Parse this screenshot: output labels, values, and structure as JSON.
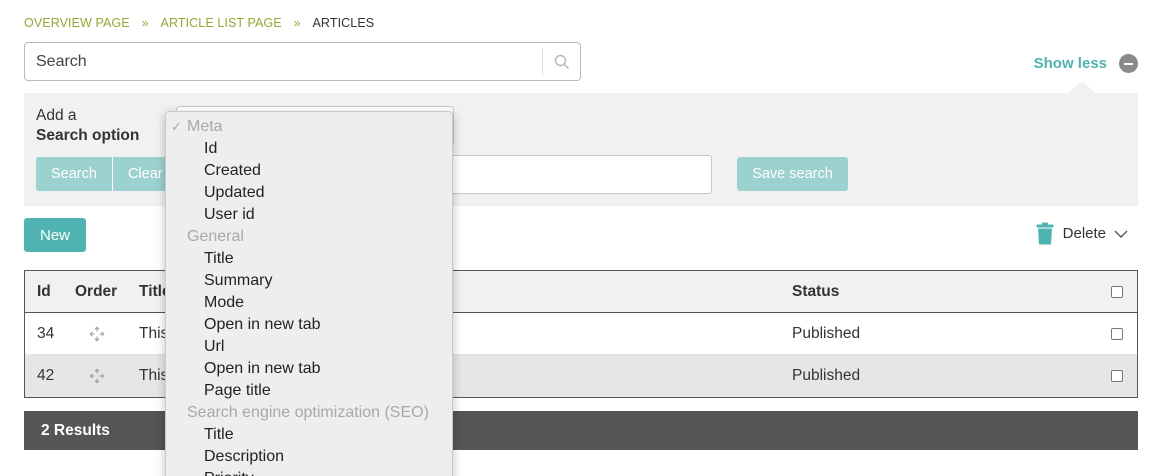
{
  "breadcrumb": {
    "items": [
      "OVERVIEW PAGE",
      "ARTICLE LIST PAGE"
    ],
    "separator": "»",
    "current": "ARTICLES"
  },
  "search": {
    "placeholder": "Search"
  },
  "toggle": {
    "show_less_label": "Show less"
  },
  "options_panel": {
    "add_label_line1": "Add a",
    "add_label_line2": "Search option",
    "search_button": "Search",
    "clear_button": "Clear",
    "save_button": "Save search"
  },
  "toolbar": {
    "new_button": "New",
    "delete_label": "Delete"
  },
  "table": {
    "headers": {
      "id": "Id",
      "order": "Order",
      "title": "Title",
      "status": "Status"
    },
    "rows": [
      {
        "id": "34",
        "title": "This",
        "status": "Published"
      },
      {
        "id": "42",
        "title": "This",
        "status": "Published"
      }
    ]
  },
  "results": {
    "label": "2 Results"
  },
  "dropdown": {
    "groups": [
      {
        "label": "Meta",
        "items": [
          "Id",
          "Created",
          "Updated",
          "User id"
        ]
      },
      {
        "label": "General",
        "items": [
          "Title",
          "Summary",
          "Mode",
          "Open in new tab",
          "Url",
          "Open in new tab",
          "Page title"
        ]
      },
      {
        "label": "Search engine optimization (SEO)",
        "items": [
          "Title",
          "Description",
          "Priority"
        ]
      }
    ]
  },
  "colors": {
    "accent": "#4fb3b1",
    "accent_light": "#9bd2d0",
    "breadcrumb": "#8fa832",
    "results_bar": "#555555"
  }
}
